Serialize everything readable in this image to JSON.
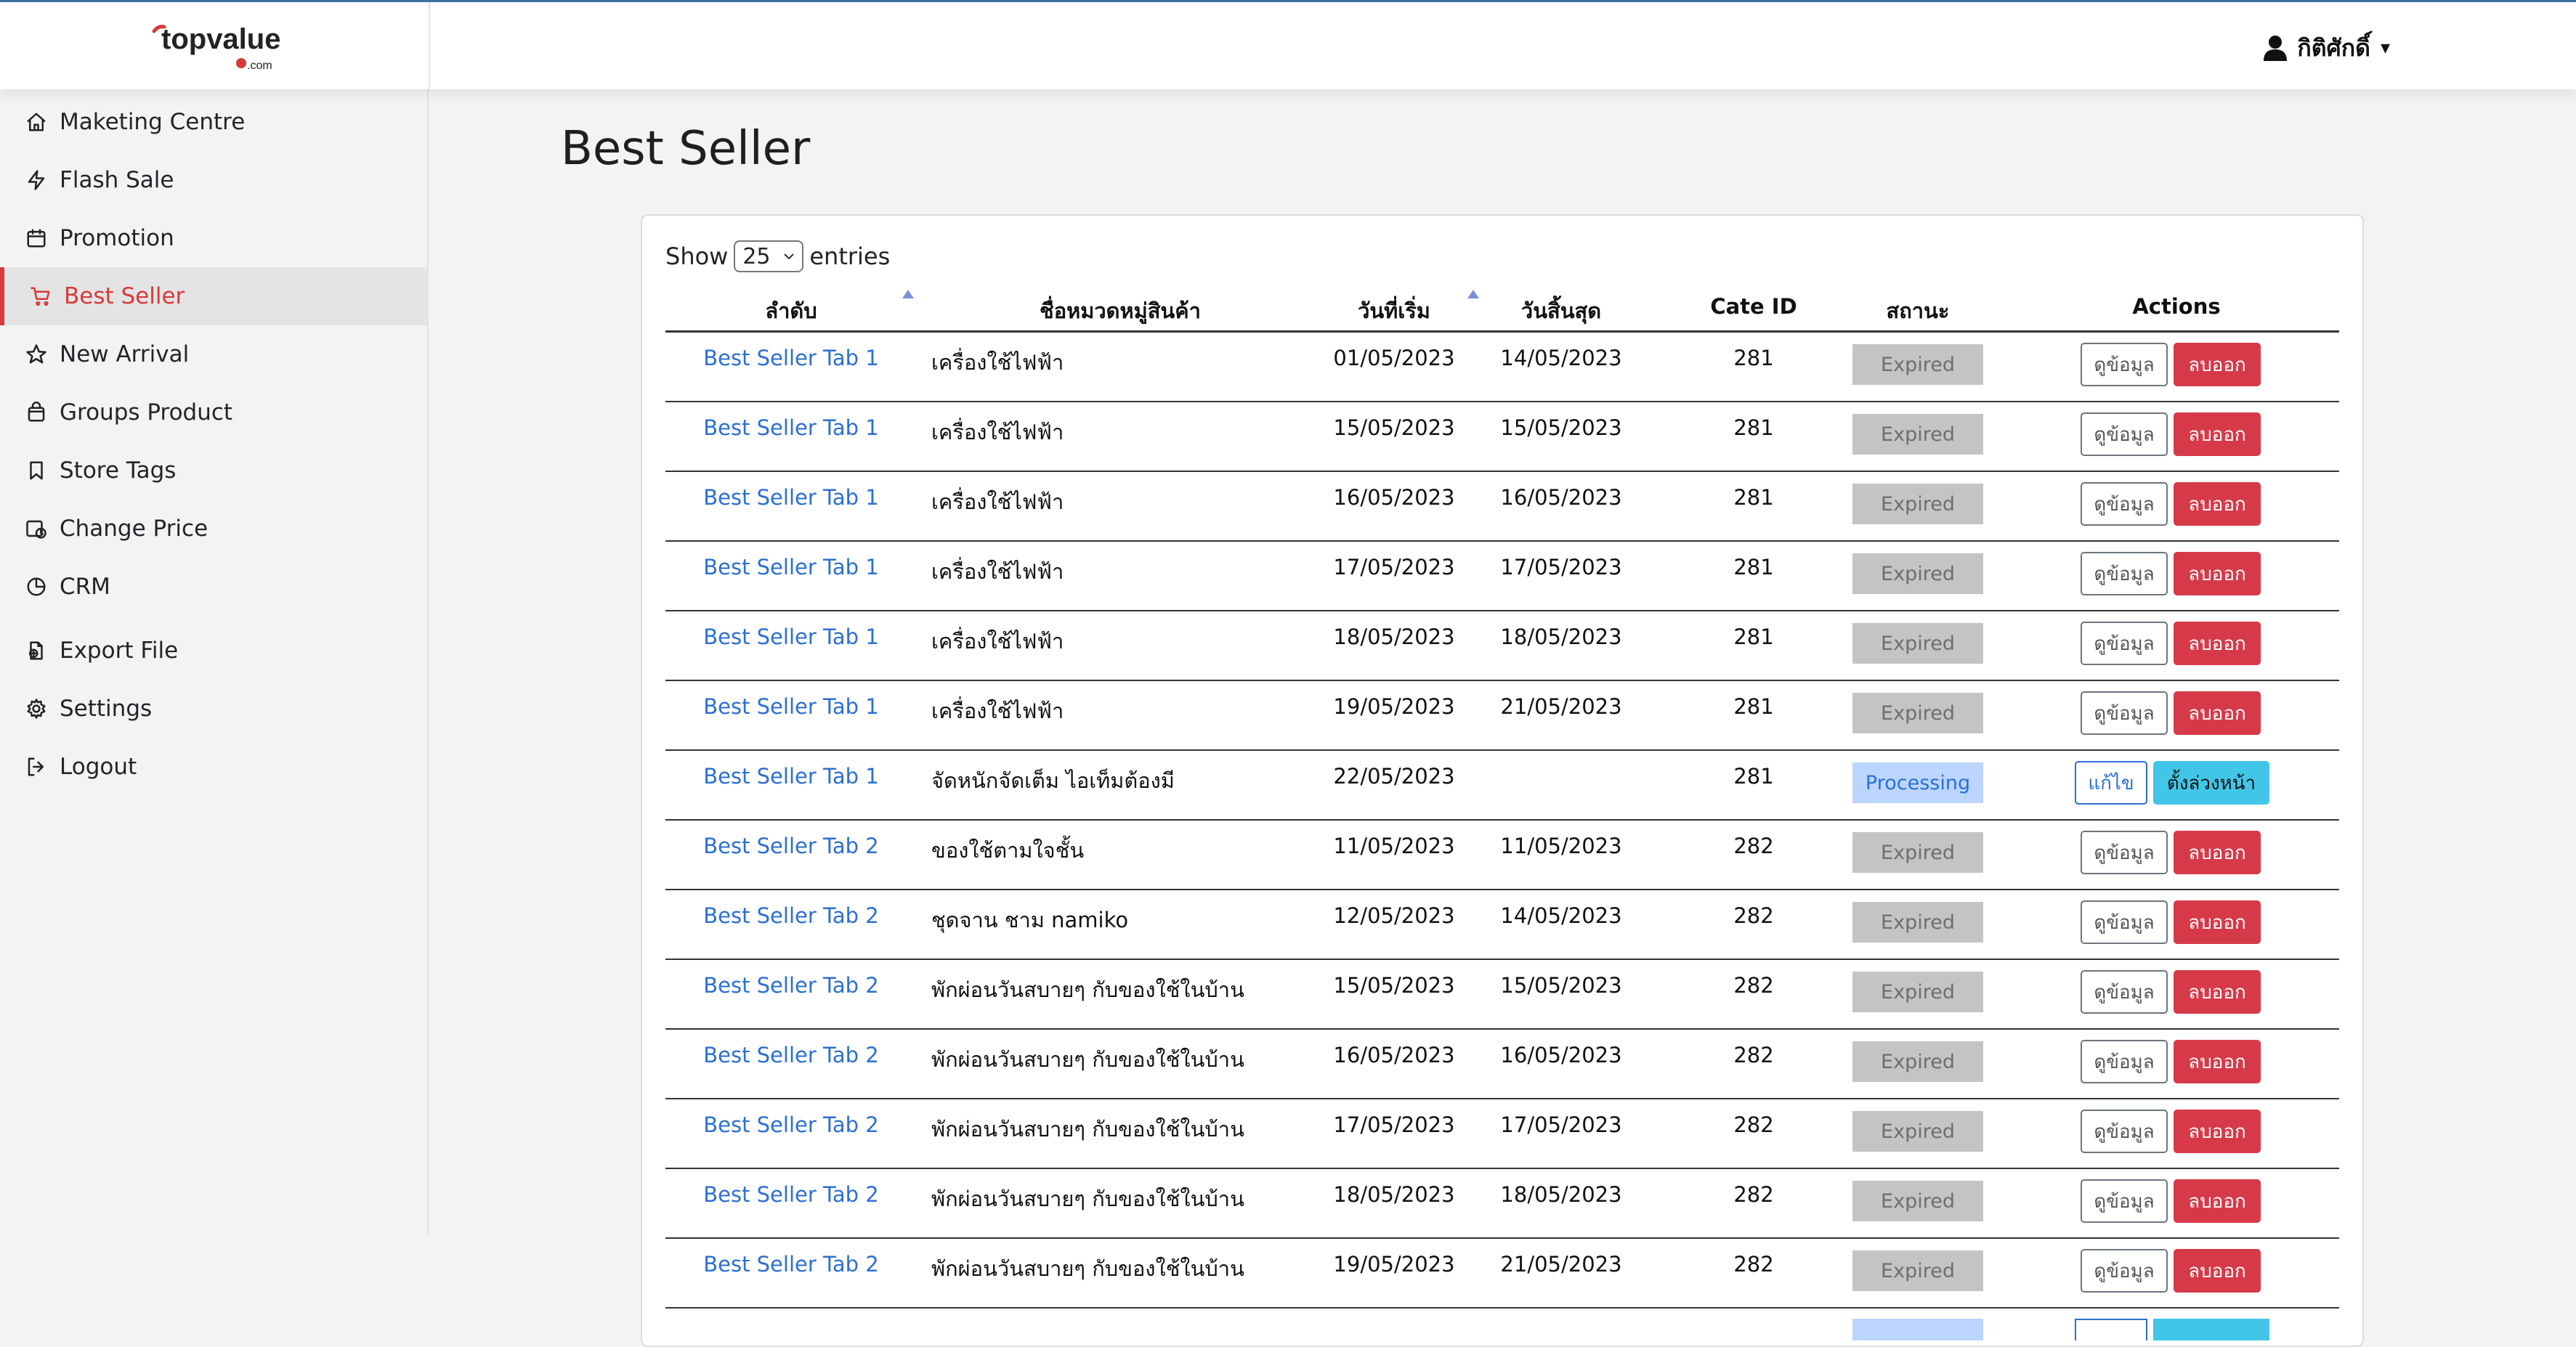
{
  "brand": {
    "name": "topvalue",
    "suffix": ".com",
    "colors": {
      "accent": "#d63a3a",
      "link": "#2c6fd1",
      "processing": "#bcd5ff",
      "schedule": "#42c6e8"
    }
  },
  "user": {
    "name": "กิติศักดิ์",
    "icon": "user-icon",
    "caret": "▾"
  },
  "sidebar": {
    "items": [
      {
        "label": "Maketing Centre",
        "icon": "home-icon"
      },
      {
        "label": "Flash Sale",
        "icon": "lightning-icon"
      },
      {
        "label": "Promotion",
        "icon": "calendar-icon"
      },
      {
        "label": "Best Seller",
        "icon": "cart-icon",
        "active": true
      },
      {
        "label": "New Arrival",
        "icon": "star-icon"
      },
      {
        "label": "Groups Product",
        "icon": "bag-icon"
      },
      {
        "label": "Store Tags",
        "icon": "bookmark-icon"
      },
      {
        "label": "Change Price",
        "icon": "price-change-icon"
      },
      {
        "label": "CRM",
        "icon": "pie-chart-icon"
      },
      {
        "label": "Export File",
        "icon": "file-export-icon"
      },
      {
        "label": "Settings",
        "icon": "gear-icon"
      },
      {
        "label": "Logout",
        "icon": "logout-icon"
      }
    ]
  },
  "page": {
    "title": "Best Seller"
  },
  "table": {
    "show_label": "Show",
    "entries_value": "25",
    "entries_label": "entries",
    "headers": {
      "rank": "ลำดับ",
      "category": "ชื่อหมวดหมู่สินค้า",
      "start": "วันที่เริ่ม",
      "end": "วันสิ้นสุด",
      "cate_id": "Cate ID",
      "status": "สถานะ",
      "actions": "Actions"
    },
    "labels": {
      "view": "ดูข้อมูล",
      "delete": "ลบออก",
      "edit": "แก้ไข",
      "schedule": "ตั้งล่วงหน้า"
    },
    "rows": [
      {
        "rank": "Best Seller Tab 1",
        "name": "เครื่องใช้ไฟฟ้า",
        "start": "01/05/2023",
        "end": "14/05/2023",
        "cate_id": "281",
        "status": "Expired"
      },
      {
        "rank": "Best Seller Tab 1",
        "name": "เครื่องใช้ไฟฟ้า",
        "start": "15/05/2023",
        "end": "15/05/2023",
        "cate_id": "281",
        "status": "Expired"
      },
      {
        "rank": "Best Seller Tab 1",
        "name": "เครื่องใช้ไฟฟ้า",
        "start": "16/05/2023",
        "end": "16/05/2023",
        "cate_id": "281",
        "status": "Expired"
      },
      {
        "rank": "Best Seller Tab 1",
        "name": "เครื่องใช้ไฟฟ้า",
        "start": "17/05/2023",
        "end": "17/05/2023",
        "cate_id": "281",
        "status": "Expired"
      },
      {
        "rank": "Best Seller Tab 1",
        "name": "เครื่องใช้ไฟฟ้า",
        "start": "18/05/2023",
        "end": "18/05/2023",
        "cate_id": "281",
        "status": "Expired"
      },
      {
        "rank": "Best Seller Tab 1",
        "name": "เครื่องใช้ไฟฟ้า",
        "start": "19/05/2023",
        "end": "21/05/2023",
        "cate_id": "281",
        "status": "Expired"
      },
      {
        "rank": "Best Seller Tab 1",
        "name": "จัดหนักจัดเต็ม ไอเท็มต้องมี",
        "start": "22/05/2023",
        "end": "",
        "cate_id": "281",
        "status": "Processing"
      },
      {
        "rank": "Best Seller Tab 2",
        "name": "ของใช้ตามใจชั้น",
        "start": "11/05/2023",
        "end": "11/05/2023",
        "cate_id": "282",
        "status": "Expired"
      },
      {
        "rank": "Best Seller Tab 2",
        "name": "ชุดจาน ชาม namiko",
        "start": "12/05/2023",
        "end": "14/05/2023",
        "cate_id": "282",
        "status": "Expired"
      },
      {
        "rank": "Best Seller Tab 2",
        "name": "พักผ่อนวันสบายๆ กับของใช้ในบ้าน",
        "start": "15/05/2023",
        "end": "15/05/2023",
        "cate_id": "282",
        "status": "Expired"
      },
      {
        "rank": "Best Seller Tab 2",
        "name": "พักผ่อนวันสบายๆ กับของใช้ในบ้าน",
        "start": "16/05/2023",
        "end": "16/05/2023",
        "cate_id": "282",
        "status": "Expired"
      },
      {
        "rank": "Best Seller Tab 2",
        "name": "พักผ่อนวันสบายๆ กับของใช้ในบ้าน",
        "start": "17/05/2023",
        "end": "17/05/2023",
        "cate_id": "282",
        "status": "Expired"
      },
      {
        "rank": "Best Seller Tab 2",
        "name": "พักผ่อนวันสบายๆ กับของใช้ในบ้าน",
        "start": "18/05/2023",
        "end": "18/05/2023",
        "cate_id": "282",
        "status": "Expired"
      },
      {
        "rank": "Best Seller Tab 2",
        "name": "พักผ่อนวันสบายๆ กับของใช้ในบ้าน",
        "start": "19/05/2023",
        "end": "21/05/2023",
        "cate_id": "282",
        "status": "Expired"
      }
    ]
  }
}
